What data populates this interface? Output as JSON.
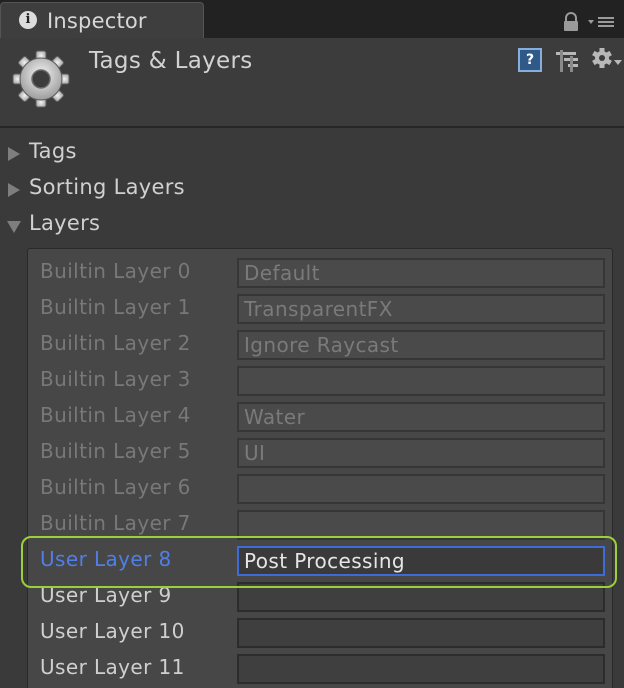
{
  "tab": {
    "label": "Inspector",
    "icon": "info-icon"
  },
  "header": {
    "title": "Tags & Layers"
  },
  "foldouts": [
    {
      "label": "Tags",
      "expanded": false
    },
    {
      "label": "Sorting Layers",
      "expanded": false
    },
    {
      "label": "Layers",
      "expanded": true
    }
  ],
  "layers": [
    {
      "name": "Builtin Layer 0",
      "value": "Default",
      "kind": "builtin"
    },
    {
      "name": "Builtin Layer 1",
      "value": "TransparentFX",
      "kind": "builtin"
    },
    {
      "name": "Builtin Layer 2",
      "value": "Ignore Raycast",
      "kind": "builtin"
    },
    {
      "name": "Builtin Layer 3",
      "value": "",
      "kind": "builtin"
    },
    {
      "name": "Builtin Layer 4",
      "value": "Water",
      "kind": "builtin"
    },
    {
      "name": "Builtin Layer 5",
      "value": "UI",
      "kind": "builtin"
    },
    {
      "name": "Builtin Layer 6",
      "value": "",
      "kind": "builtin"
    },
    {
      "name": "Builtin Layer 7",
      "value": "",
      "kind": "builtin"
    },
    {
      "name": "User Layer 8",
      "value": "Post Processing",
      "kind": "user",
      "selected": true
    },
    {
      "name": "User Layer 9",
      "value": "",
      "kind": "user"
    },
    {
      "name": "User Layer 10",
      "value": "",
      "kind": "user"
    },
    {
      "name": "User Layer 11",
      "value": "",
      "kind": "user"
    }
  ],
  "colors": {
    "selected_label": "#4f7fe6",
    "selected_border": "#3d6bd8",
    "highlight_ring": "#9ccf3a"
  }
}
